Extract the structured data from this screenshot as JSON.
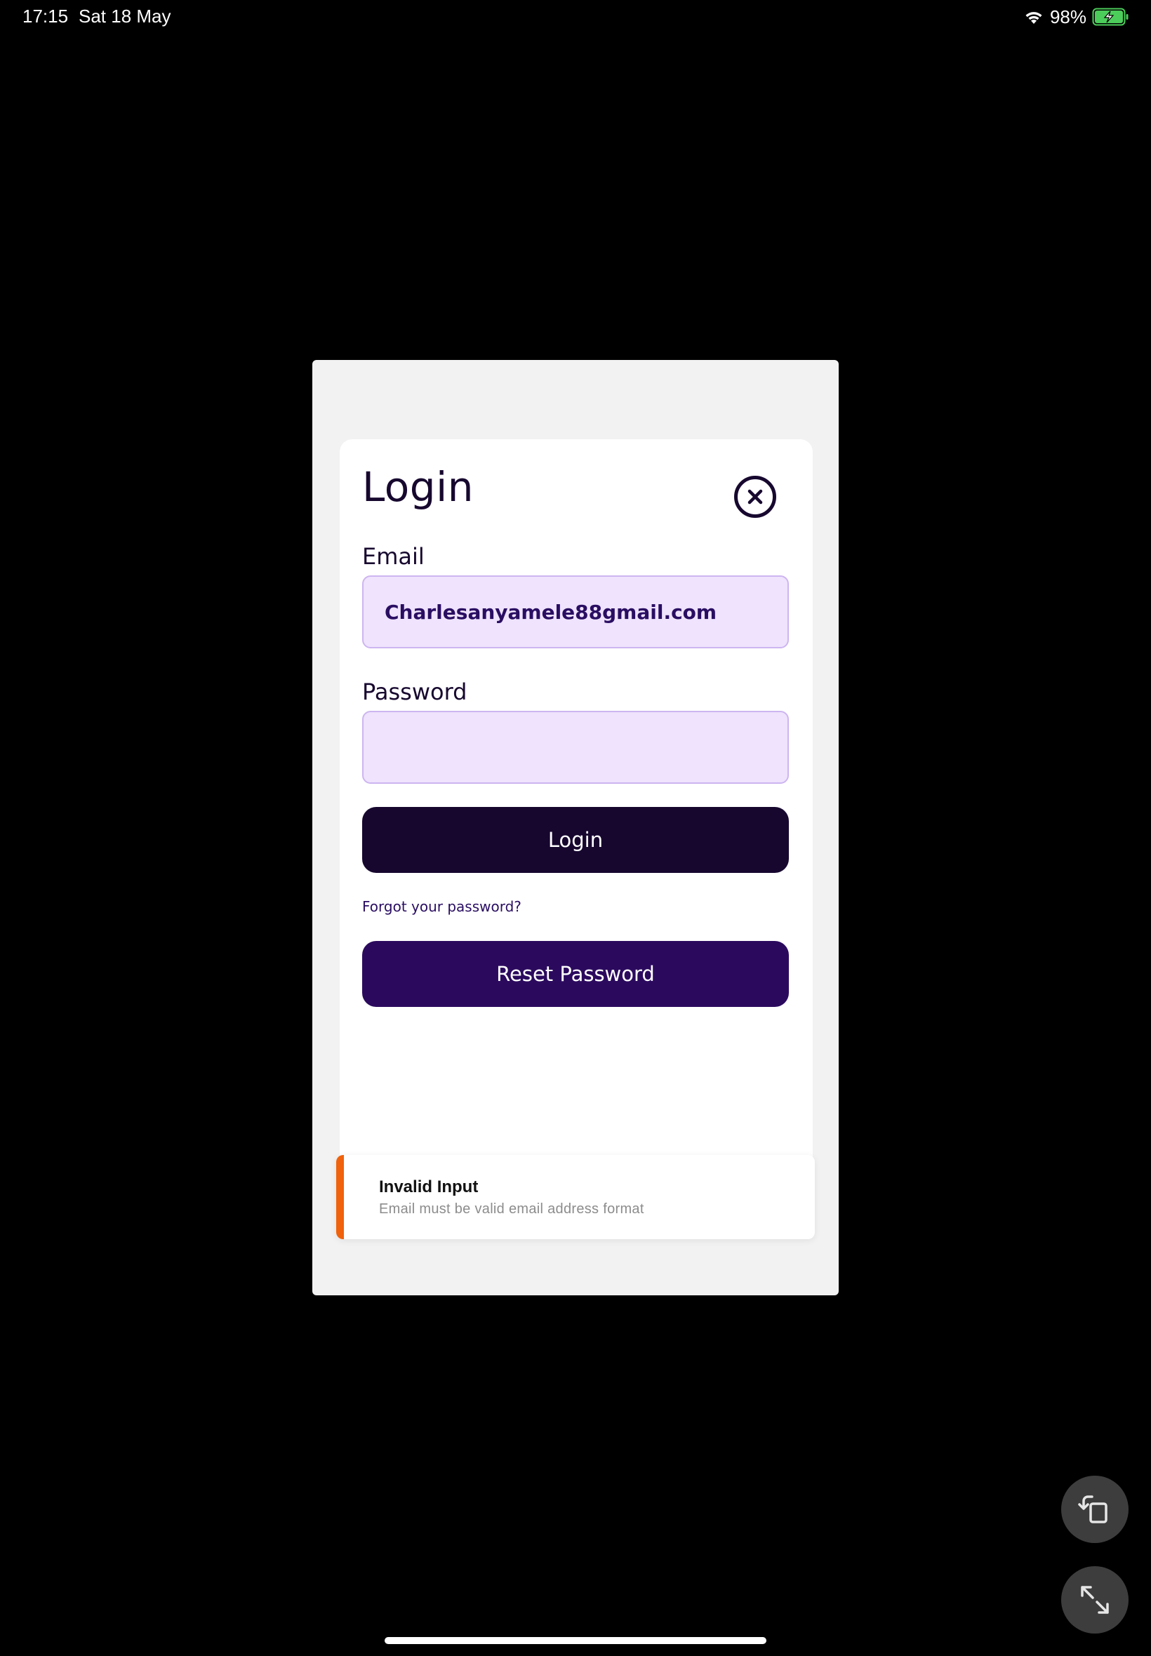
{
  "status_bar": {
    "time": "17:15",
    "date": "Sat 18 May",
    "battery_percent": "98%",
    "battery_level": 0.98,
    "charging": true,
    "icons": [
      "wifi-icon",
      "battery-charging-icon"
    ]
  },
  "login": {
    "title": "Login",
    "email_label": "Email",
    "email_value": "Charlesanyamele88gmail.com",
    "password_label": "Password",
    "password_value": "",
    "login_button": "Login",
    "forgot_link": "Forgot your password?",
    "reset_button": "Reset Password",
    "close_icon": "close-circle-icon"
  },
  "toast": {
    "title": "Invalid Input",
    "message": "Email must be valid email address format",
    "accent_color": "#f0620b"
  },
  "floating_controls": {
    "icons": [
      "rotate-window-icon",
      "expand-arrows-icon"
    ]
  },
  "colors": {
    "primary_dark": "#17072f",
    "primary_purple": "#2b0a5e",
    "input_fill": "#efe3fd",
    "input_border": "#cdb5f0"
  }
}
